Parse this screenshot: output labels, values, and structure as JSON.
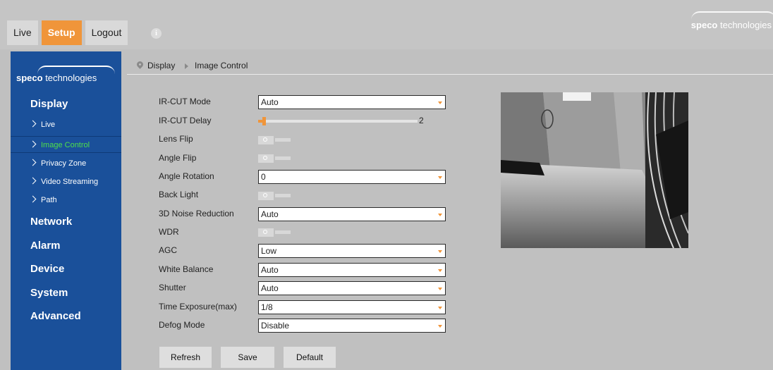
{
  "nav": {
    "live": "Live",
    "setup": "Setup",
    "logout": "Logout"
  },
  "brand": {
    "bold": "speco",
    "rest": " technologies"
  },
  "sidebar": {
    "sections": [
      "Display",
      "Network",
      "Alarm",
      "Device",
      "System",
      "Advanced"
    ],
    "display_items": [
      "Live",
      "Image Control",
      "Privacy Zone",
      "Video Streaming",
      "Path"
    ],
    "active_item": "Image Control",
    "active_color": "#4fe04a"
  },
  "breadcrumb": {
    "section": "Display",
    "page": "Image Control"
  },
  "form": {
    "ircut_mode": {
      "label": "IR-CUT Mode",
      "value": "Auto"
    },
    "ircut_delay": {
      "label": "IR-CUT Delay",
      "value": "2",
      "fraction": 0.01
    },
    "lens_flip": {
      "label": "Lens Flip",
      "state": "off"
    },
    "angle_flip": {
      "label": "Angle Flip",
      "state": "off"
    },
    "angle_rotation": {
      "label": "Angle Rotation",
      "value": "0"
    },
    "back_light": {
      "label": "Back Light",
      "state": "off"
    },
    "noise_reduction": {
      "label": "3D Noise Reduction",
      "value": "Auto"
    },
    "wdr": {
      "label": "WDR",
      "state": "off"
    },
    "agc": {
      "label": "AGC",
      "value": "Low"
    },
    "white_balance": {
      "label": "White Balance",
      "value": "Auto"
    },
    "shutter": {
      "label": "Shutter",
      "value": "Auto"
    },
    "time_exposure": {
      "label": "Time Exposure(max)",
      "value": "1/8"
    },
    "defog_mode": {
      "label": "Defog Mode",
      "value": "Disable"
    }
  },
  "buttons": {
    "refresh": "Refresh",
    "save": "Save",
    "default": "Default"
  },
  "colors": {
    "accent": "#f0953a",
    "sidebar": "#1a509a"
  },
  "icons": {
    "info": "info-icon",
    "breadcrumb": "location-pin-icon",
    "separator": "triangle-right-icon",
    "chevron": "chevron-right-icon",
    "dropdown": "caret-down-icon"
  }
}
